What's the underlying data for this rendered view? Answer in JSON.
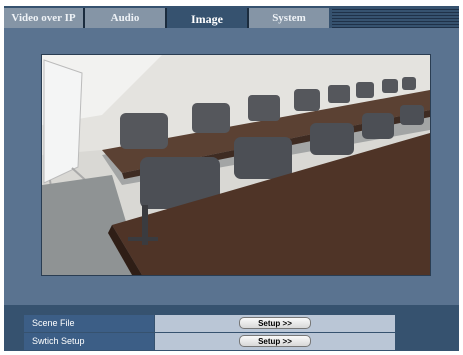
{
  "tabs": [
    {
      "label": "Video over IP",
      "active": false
    },
    {
      "label": "Audio",
      "active": false
    },
    {
      "label": "Image",
      "active": true
    },
    {
      "label": "System",
      "active": false
    }
  ],
  "camera_view": {
    "description_icon": "camera-feed-image"
  },
  "settings": {
    "scene_file": {
      "label": "Scene File",
      "button": "Setup >>"
    },
    "switch_setup": {
      "label": "Swtich Setup",
      "button": "Setup >>"
    }
  },
  "colors": {
    "frame": "#36526f",
    "content": "#5a7390",
    "row_label": "#3c5e86",
    "row_value": "#bac6d6",
    "tab_inactive": "#8595a6"
  }
}
